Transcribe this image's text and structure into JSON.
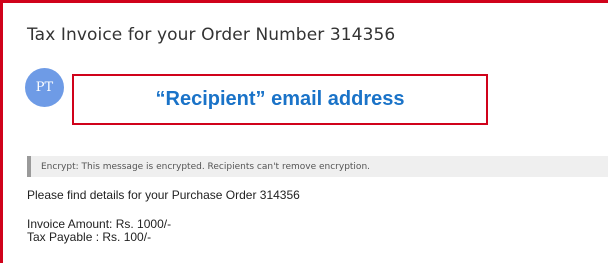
{
  "email": {
    "subject": "Tax Invoice for your Order Number 314356",
    "avatar_initials": "PT",
    "recipient_label": "“Recipient” email address",
    "encryption_notice": "Encrypt: This message is encrypted. Recipients can't remove encryption.",
    "body": {
      "line1": "Please find details for your Purchase Order 314356",
      "line2": "Invoice Amount: Rs. 1000/-",
      "line3": "Tax Payable : Rs. 100/-"
    }
  },
  "colors": {
    "highlight_border": "#d0021b",
    "avatar_bg": "#6e9be6",
    "recipient_text": "#1a73c8"
  }
}
